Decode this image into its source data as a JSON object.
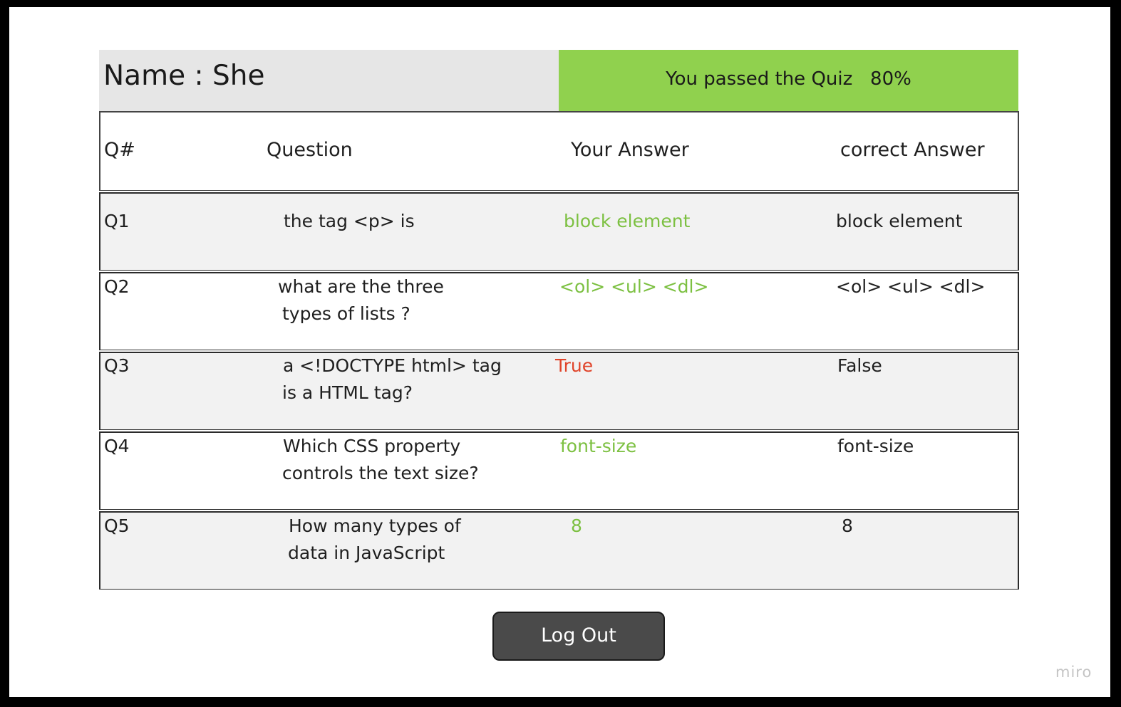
{
  "header": {
    "name_label": "Name : She",
    "result_text": "You passed the Quiz   80%",
    "result_color": "#90d14e"
  },
  "table": {
    "columns": [
      "Q#",
      "Question",
      "Your Answer",
      "correct Answer"
    ],
    "rows": [
      {
        "num": "Q1",
        "question_line1": "the tag <p> is",
        "question_line2": "",
        "your_answer": "block element",
        "correct_answer": "block element",
        "is_correct": true
      },
      {
        "num": "Q2",
        "question_line1": "what are the three",
        "question_line2": "types of lists ?",
        "your_answer": "<ol> <ul> <dl>",
        "correct_answer": "<ol> <ul> <dl>",
        "is_correct": true
      },
      {
        "num": "Q3",
        "question_line1": "a <!DOCTYPE html> tag",
        "question_line2": "is a HTML tag?",
        "your_answer": "True",
        "correct_answer": "False",
        "is_correct": false
      },
      {
        "num": "Q4",
        "question_line1": "Which CSS property",
        "question_line2": "controls the text size?",
        "your_answer": "font-size",
        "correct_answer": "font-size",
        "is_correct": true
      },
      {
        "num": "Q5",
        "question_line1": "How many types of",
        "question_line2": "data in JavaScript",
        "your_answer": "8",
        "correct_answer": "8",
        "is_correct": true
      }
    ]
  },
  "actions": {
    "logout_label": "Log Out"
  },
  "watermark": "miro",
  "colors": {
    "correct": "#7cc041",
    "incorrect": "#e0442a",
    "button": "#4a4a4a"
  }
}
